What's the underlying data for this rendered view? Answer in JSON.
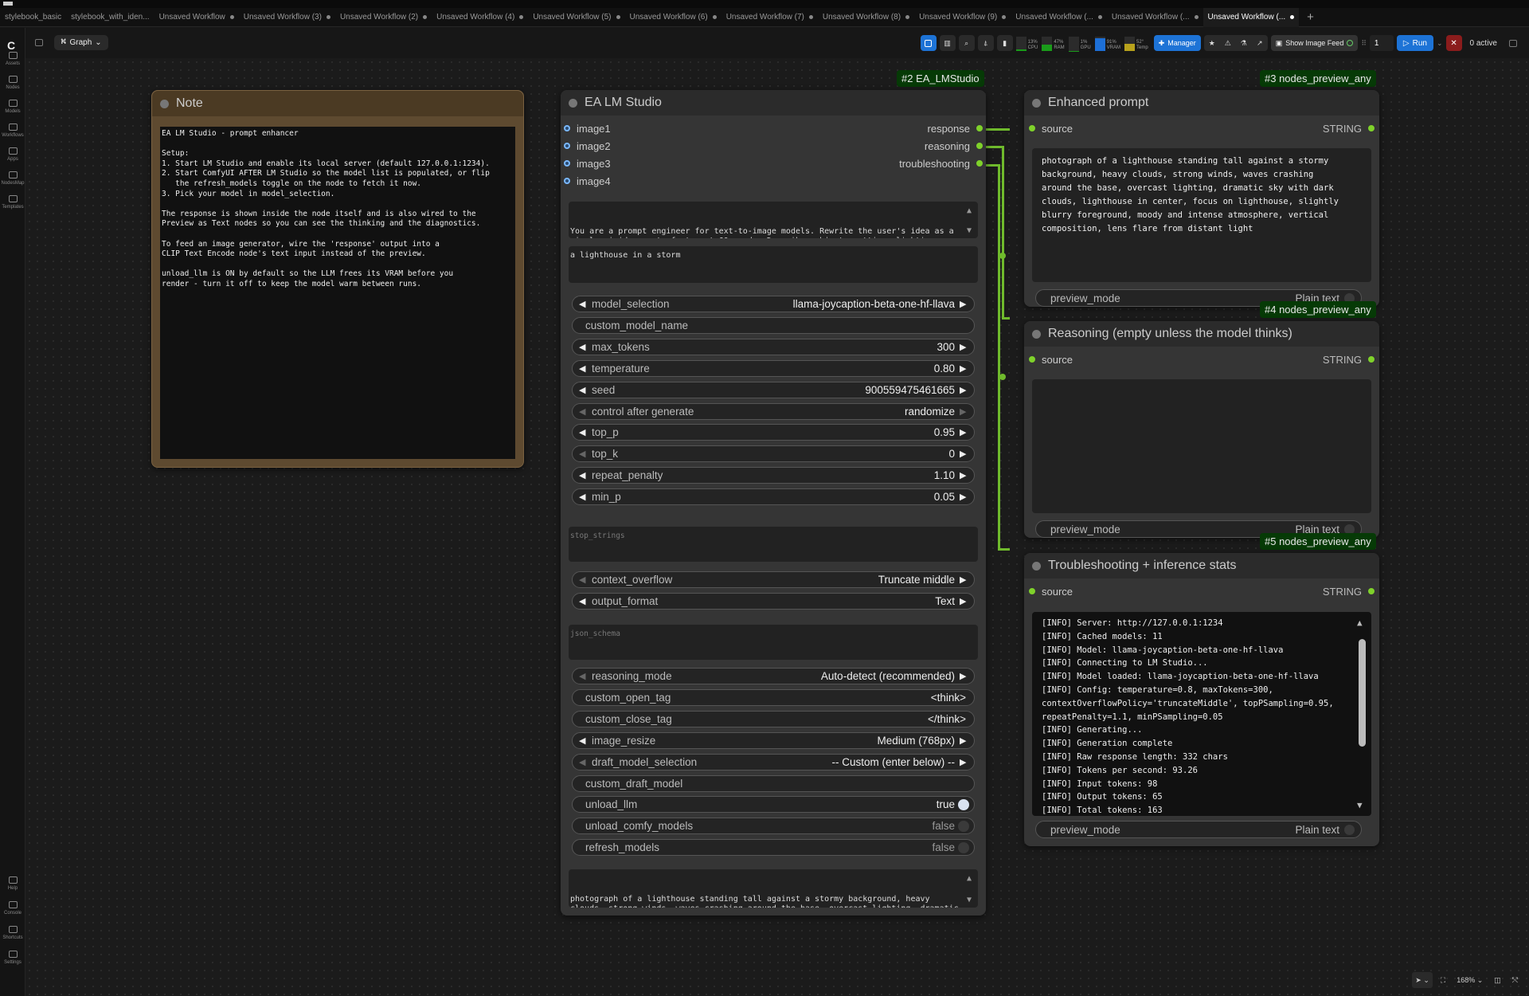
{
  "tabs": [
    {
      "label": "stylebook_basic",
      "dot": false,
      "active": false
    },
    {
      "label": "stylebook_with_iden...",
      "dot": false,
      "active": false
    },
    {
      "label": "Unsaved Workflow",
      "dot": true,
      "active": false
    },
    {
      "label": "Unsaved Workflow (3)",
      "dot": true,
      "active": false
    },
    {
      "label": "Unsaved Workflow (2)",
      "dot": true,
      "active": false
    },
    {
      "label": "Unsaved Workflow (4)",
      "dot": true,
      "active": false
    },
    {
      "label": "Unsaved Workflow (5)",
      "dot": true,
      "active": false
    },
    {
      "label": "Unsaved Workflow (6)",
      "dot": true,
      "active": false
    },
    {
      "label": "Unsaved Workflow (7)",
      "dot": true,
      "active": false
    },
    {
      "label": "Unsaved Workflow (8)",
      "dot": true,
      "active": false
    },
    {
      "label": "Unsaved Workflow (9)",
      "dot": true,
      "active": false
    },
    {
      "label": "Unsaved Workflow (...",
      "dot": true,
      "active": false
    },
    {
      "label": "Unsaved Workflow (...",
      "dot": true,
      "active": false
    },
    {
      "label": "Unsaved Workflow (...",
      "dot": true,
      "active": true
    }
  ],
  "tab_add": "+",
  "sidebar": {
    "logo": "C",
    "items": [
      {
        "label": "Assets",
        "icon": "image-icon"
      },
      {
        "label": "Nodes",
        "icon": "nodes-icon"
      },
      {
        "label": "Models",
        "icon": "models-icon"
      },
      {
        "label": "Workflows",
        "icon": "workflows-icon"
      },
      {
        "label": "Apps",
        "icon": "apps-icon"
      },
      {
        "label": "NodesMap",
        "icon": "nodesmap-icon"
      },
      {
        "label": "Templates",
        "icon": "templates-icon"
      }
    ],
    "bottom_items": [
      {
        "label": "Help",
        "icon": "help-icon"
      },
      {
        "label": "Console",
        "icon": "console-icon"
      },
      {
        "label": "Shortcuts",
        "icon": "shortcuts-icon"
      },
      {
        "label": "Settings",
        "icon": "settings-icon"
      }
    ]
  },
  "toolbar": {
    "graph_label": "Graph",
    "monitors": [
      {
        "label": "CPU",
        "value": "13%",
        "level": 0.13,
        "color": "#1a9c1a"
      },
      {
        "label": "RAM",
        "value": "47%",
        "level": 0.47,
        "color": "#1a9c1a"
      },
      {
        "label": "GPU",
        "value": "1%",
        "level": 0.01,
        "color": "#1a9c1a"
      },
      {
        "label": "VRAM",
        "value": "91%",
        "level": 0.91,
        "color": "#1d6fd6"
      },
      {
        "label": "Temp",
        "value": "52°",
        "level": 0.52,
        "color": "#b8a21c"
      }
    ],
    "manager_label": "Manager",
    "image_feed_label": "Show Image Feed",
    "batch_count": "1",
    "run_label": "Run",
    "stop_label": "✕",
    "active_label": "0 active"
  },
  "note_node": {
    "title": "Note",
    "text": "EA LM Studio - prompt enhancer\n\nSetup:\n1. Start LM Studio and enable its local server (default 127.0.0.1:1234).\n2. Start ComfyUI AFTER LM Studio so the model list is populated, or flip\n   the refresh_models toggle on the node to fetch it now.\n3. Pick your model in model_selection.\n\nThe response is shown inside the node itself and is also wired to the\nPreview as Text nodes so you can see the thinking and the diagnostics.\n\nTo feed an image generator, wire the 'response' output into a\nCLIP Text Encode node's text input instead of the preview.\n\nunload_llm is ON by default so the LLM frees its VRAM before you\nrender - turn it off to keep the model warm between runs."
  },
  "lm_node": {
    "badge": "#2 EA_LMStudio",
    "title": "EA LM Studio",
    "inputs": [
      "image1",
      "image2",
      "image3",
      "image4"
    ],
    "outputs": [
      "response",
      "reasoning",
      "troubleshooting"
    ],
    "system_prompt": "You are a prompt engineer for text-to-image models. Rewrite the user's idea as a single vivid prompt of at most 60 words. Describe subject, setting, lighting, composition and lens. Output the prompt only - no preamble, no quotes, no bullet points.",
    "user_prompt": "a lighthouse in a storm",
    "widgets1": [
      {
        "name": "model_selection",
        "value": "llama-joycaption-beta-one-hf-llava",
        "kind": "combo"
      },
      {
        "name": "custom_model_name",
        "value": "",
        "kind": "text"
      },
      {
        "name": "max_tokens",
        "value": "300",
        "kind": "number"
      },
      {
        "name": "temperature",
        "value": "0.80",
        "kind": "number"
      },
      {
        "name": "seed",
        "value": "900559475461665",
        "kind": "number"
      },
      {
        "name": "control after generate",
        "value": "randomize",
        "kind": "combo-dim"
      },
      {
        "name": "top_p",
        "value": "0.95",
        "kind": "number"
      },
      {
        "name": "top_k",
        "value": "0",
        "kind": "number-dim"
      },
      {
        "name": "repeat_penalty",
        "value": "1.10",
        "kind": "number"
      },
      {
        "name": "min_p",
        "value": "0.05",
        "kind": "number"
      }
    ],
    "stop_strings_placeholder": "stop_strings",
    "widgets2": [
      {
        "name": "context_overflow",
        "value": "Truncate middle",
        "kind": "combo-dim"
      },
      {
        "name": "output_format",
        "value": "Text",
        "kind": "combo"
      }
    ],
    "json_schema_placeholder": "json_schema",
    "widgets3": [
      {
        "name": "reasoning_mode",
        "value": "Auto-detect (recommended)",
        "kind": "combo-dim"
      },
      {
        "name": "custom_open_tag",
        "value": "<think>",
        "kind": "text"
      },
      {
        "name": "custom_close_tag",
        "value": "</think>",
        "kind": "text"
      },
      {
        "name": "image_resize",
        "value": "Medium (768px)",
        "kind": "combo"
      },
      {
        "name": "draft_model_selection",
        "value": "-- Custom (enter below) --",
        "kind": "combo-dim"
      },
      {
        "name": "custom_draft_model",
        "value": "",
        "kind": "text"
      },
      {
        "name": "unload_llm",
        "value": "true",
        "kind": "toggle-on"
      },
      {
        "name": "unload_comfy_models",
        "value": "false",
        "kind": "toggle-off"
      },
      {
        "name": "refresh_models",
        "value": "false",
        "kind": "toggle-off"
      }
    ],
    "response_text": "photograph of a lighthouse standing tall against a stormy background, heavy clouds, strong winds, waves crashing around the base, overcast lighting, dramatic sky with dark clouds, lighthouse in center, focus on lighthouse, slightly blurry foreground, moody and intense atmosphere, vertical"
  },
  "preview1": {
    "badge": "#3 nodes_preview_any",
    "title": "Enhanced prompt",
    "input": "source",
    "type": "STRING",
    "text": "photograph of a lighthouse standing tall against a stormy\nbackground, heavy clouds, strong winds, waves crashing\naround the base, overcast lighting, dramatic sky with dark\nclouds, lighthouse in center, focus on lighthouse, slightly\nblurry foreground, moody and intense atmosphere, vertical\ncomposition, lens flare from distant light",
    "mode_label": "preview_mode",
    "mode_value": "Plain text"
  },
  "preview2": {
    "badge": "#4 nodes_preview_any",
    "title": "Reasoning (empty unless the model thinks)",
    "input": "source",
    "type": "STRING",
    "text": "",
    "mode_label": "preview_mode",
    "mode_value": "Plain text"
  },
  "preview3": {
    "badge": "#5 nodes_preview_any",
    "title": "Troubleshooting + inference stats",
    "input": "source",
    "type": "STRING",
    "log": [
      "[INFO] Server: http://127.0.0.1:1234",
      "[INFO] Cached models: 11",
      "[INFO] Model: llama-joycaption-beta-one-hf-llava",
      "[INFO] Connecting to LM Studio...",
      "[INFO] Model loaded: llama-joycaption-beta-one-hf-llava",
      "[INFO] Config: temperature=0.8, maxTokens=300,",
      "contextOverflowPolicy='truncateMiddle', topPSampling=0.95,",
      "repeatPenalty=1.1, minPSampling=0.05",
      "[INFO] Generating...",
      "[INFO] Generation complete",
      "[INFO] Raw response length: 332 chars",
      "[INFO] Tokens per second: 93.26",
      "[INFO] Input tokens: 98",
      "[INFO] Output tokens: 65",
      "[INFO] Total tokens: 163"
    ],
    "mode_label": "preview_mode",
    "mode_value": "Plain text"
  },
  "canvas_controls": {
    "zoom": "168%"
  },
  "colors": {
    "accent": "#1d73d6",
    "wire": "#6fba2c",
    "badge_bg": "#063a06",
    "note_bg": "#5e4a30"
  }
}
